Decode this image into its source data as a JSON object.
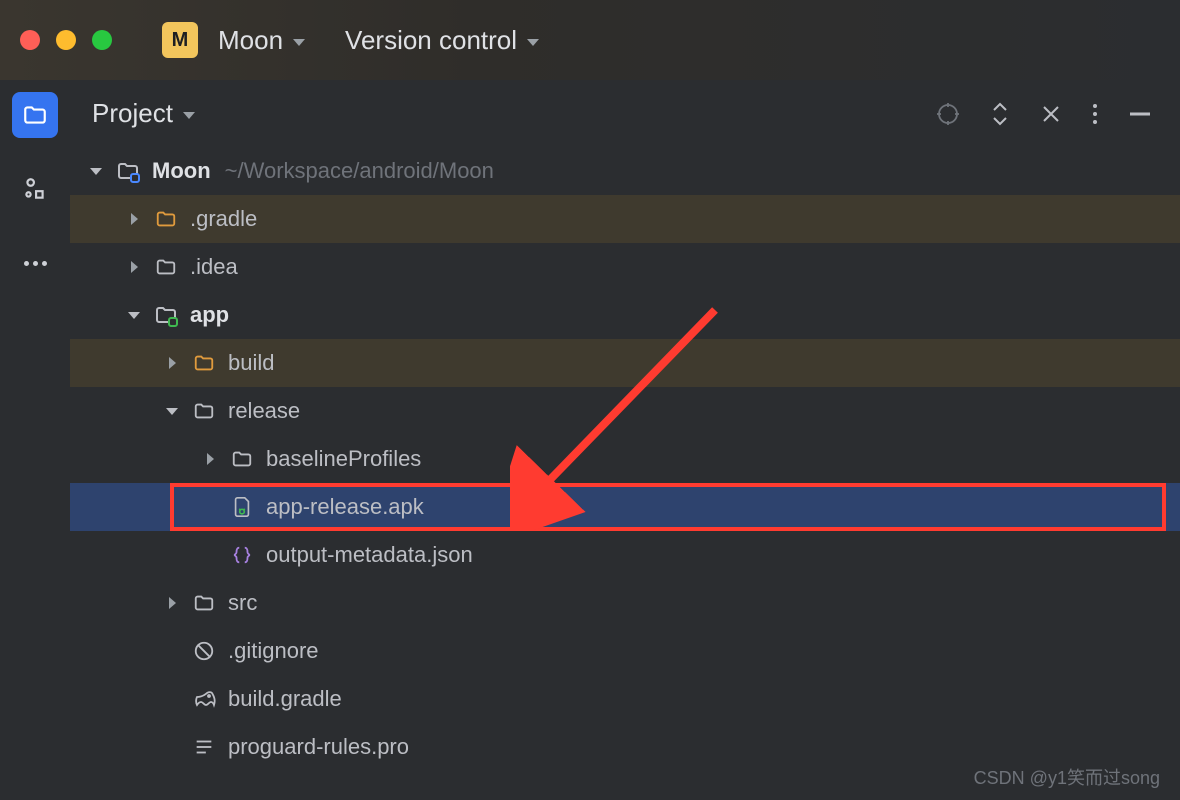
{
  "titlebar": {
    "project_badge": "M",
    "project_name": "Moon",
    "vcs_label": "Version control"
  },
  "panel": {
    "title": "Project"
  },
  "tree": {
    "root": {
      "name": "Moon",
      "path": "~/Workspace/android/Moon"
    },
    "items": {
      "gradle": ".gradle",
      "idea": ".idea",
      "app": "app",
      "build": "build",
      "release": "release",
      "baselineProfiles": "baselineProfiles",
      "apk": "app-release.apk",
      "output_json": "output-metadata.json",
      "src": "src",
      "gitignore": ".gitignore",
      "build_gradle": "build.gradle",
      "proguard": "proguard-rules.pro"
    }
  },
  "watermark": "CSDN @y1笑而过song"
}
